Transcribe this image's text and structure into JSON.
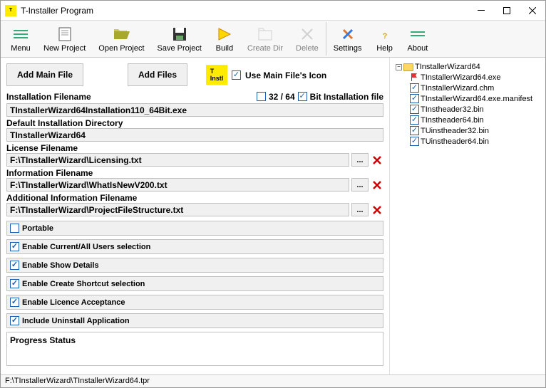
{
  "window": {
    "title": "T-Installer Program"
  },
  "toolbar": {
    "menu": "Menu",
    "new_project": "New Project",
    "open_project": "Open Project",
    "save_project": "Save Project",
    "build": "Build",
    "create_dir": "Create Dir",
    "delete": "Delete",
    "settings": "Settings",
    "help": "Help",
    "about": "About"
  },
  "buttons": {
    "add_main_file": "Add Main File",
    "add_files": "Add Files"
  },
  "main_icon": {
    "use_label": "Use Main File's Icon",
    "checked": true
  },
  "labels": {
    "install_filename": "Installation Filename",
    "default_dir": "Default Installation Directory",
    "license": "License Filename",
    "info": "Information Filename",
    "addl_info": "Additional Information Filename",
    "bit32_64": "32 / 64",
    "bit_install": "Bit Installation file"
  },
  "fields": {
    "install_filename": "TInstallerWizard64Installation110_64Bit.exe",
    "default_dir": "TInstallerWizard64",
    "license": "F:\\TInstallerWizard\\Licensing.txt",
    "info": "F:\\TInstallerWizard\\WhatIsNewV200.txt",
    "addl_info": "F:\\TInstallerWizard\\ProjectFileStructure.txt"
  },
  "bits": {
    "chk32_64": false,
    "chk_bit": true
  },
  "options": {
    "portable": {
      "label": "Portable",
      "checked": false
    },
    "users": {
      "label": "Enable Current/All Users selection",
      "checked": true
    },
    "details": {
      "label": "Enable Show Details",
      "checked": true
    },
    "shortcut": {
      "label": "Enable Create Shortcut selection",
      "checked": true
    },
    "licence": {
      "label": "Enable Licence Acceptance",
      "checked": true
    },
    "uninstall": {
      "label": "Include Uninstall Application",
      "checked": true
    }
  },
  "progress": {
    "label": "Progress Status"
  },
  "tree": {
    "root": "TInstallerWizard64",
    "items": [
      {
        "name": "TInstallerWizard64.exe",
        "checked": false,
        "flag": true
      },
      {
        "name": "TInstallerWizard.chm",
        "checked": true
      },
      {
        "name": "TInstallerWizard64.exe.manifest",
        "checked": true
      },
      {
        "name": "TInstheader32.bin",
        "checked": true
      },
      {
        "name": "TInstheader64.bin",
        "checked": true
      },
      {
        "name": "TUinstheader32.bin",
        "checked": true
      },
      {
        "name": "TUinstheader64.bin",
        "checked": true
      }
    ]
  },
  "status": {
    "path": "F:\\TInstallerWizard\\TInstallerWizard64.tpr"
  }
}
